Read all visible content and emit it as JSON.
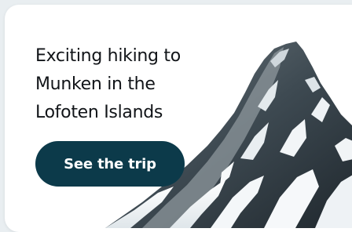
{
  "card": {
    "headline_line1": "Exciting hiking to",
    "headline_line2": "Munken in the",
    "headline_line3": "Lofoten Islands",
    "cta_label": "See the trip"
  },
  "colors": {
    "page_background": "#e9eef1",
    "card_background": "#ffffff",
    "cta_background": "#0c3a4a",
    "cta_text": "#ffffff",
    "headline_text": "#111418"
  },
  "image": {
    "subject": "snow-mountain-peak"
  }
}
